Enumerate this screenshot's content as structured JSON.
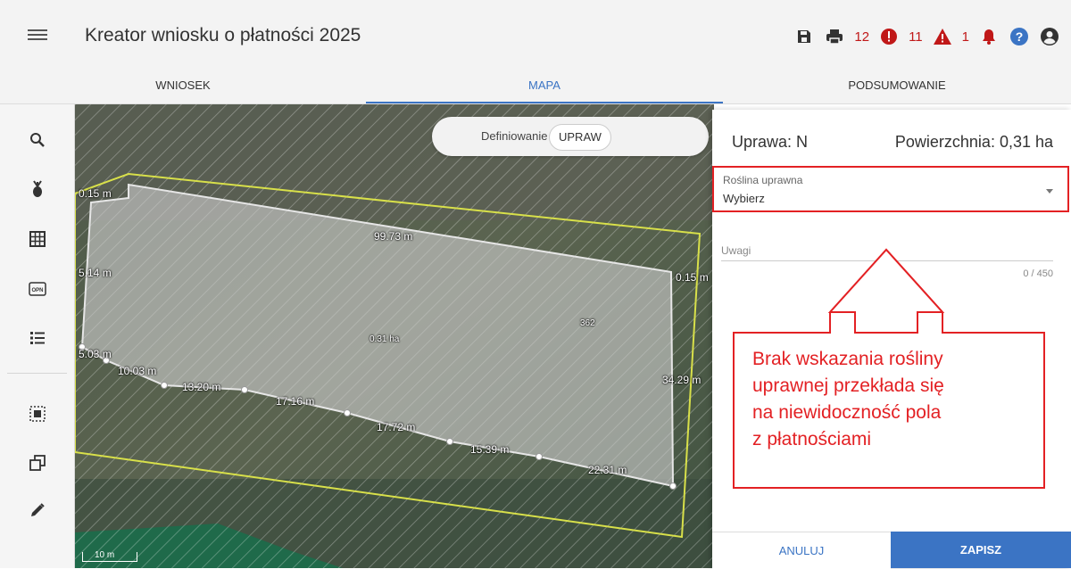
{
  "header": {
    "title": "Kreator wniosku o płatności 2025",
    "counts": {
      "errors": "12",
      "warnings": "11",
      "notifications": "1"
    }
  },
  "tabs": [
    {
      "label": "WNIOSEK"
    },
    {
      "label": "MAPA"
    },
    {
      "label": "PODSUMOWANIE"
    }
  ],
  "toolbar_icons": [
    "search-icon",
    "crop-icon",
    "grid-icon",
    "opn-icon",
    "list-icon",
    "select-area-icon",
    "copy-icon",
    "edit-icon"
  ],
  "map": {
    "mode_label": "Definiowanie",
    "mode_chip": "UPRAW",
    "labels": {
      "top_left": "0.15 m",
      "top": "99.73 m",
      "left": "5.14 m",
      "right_top": "0.15 m",
      "bl1": "5.03 m",
      "bl2": "10.03 m",
      "b1": "13.20 m",
      "b2": "17.16 m",
      "b3": "17.72 m",
      "b4": "15.39 m",
      "b5": "22.31 m",
      "right": "34.29 m",
      "area": "0.31 ha",
      "parcel_id": "362"
    },
    "scale": "10 m"
  },
  "panel": {
    "crop_title": "Uprawa: N",
    "area": "Powierzchnia: 0,31 ha",
    "select_label": "Roślina uprawna",
    "select_value": "Wybierz",
    "notes_label": "Uwagi",
    "notes_counter": "0 / 450",
    "cancel": "ANULUJ",
    "save": "ZAPISZ"
  },
  "annotation": {
    "lines": [
      "Brak wskazania rośliny",
      "uprawnej przekłada się",
      "na niewidoczność pola",
      "z płatnościami"
    ]
  },
  "colors": {
    "accent": "#3b74c4",
    "annotation": "#e32124",
    "error": "#c01818",
    "parcel_border": "#d8e04a"
  }
}
